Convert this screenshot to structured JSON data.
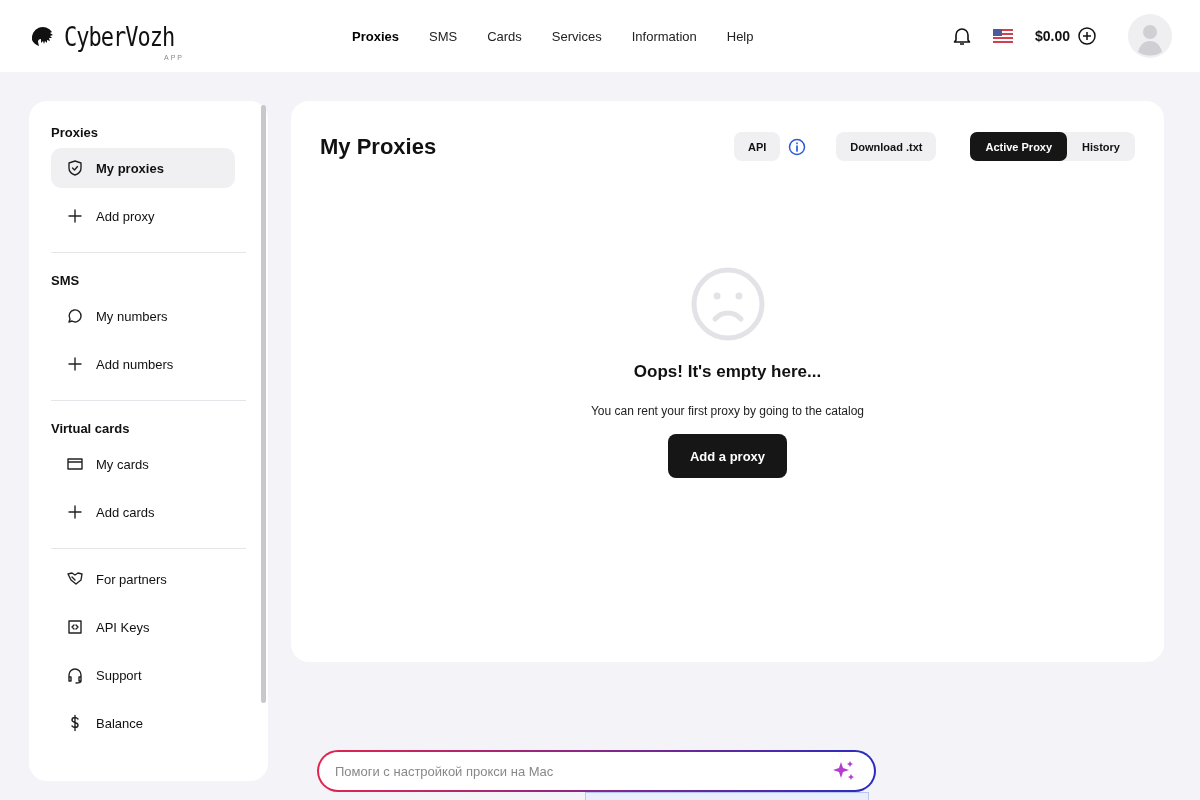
{
  "header": {
    "logo": {
      "name": "CyberVozh",
      "sub": "APP"
    },
    "nav": [
      {
        "label": "Proxies",
        "selected": true
      },
      {
        "label": "SMS",
        "selected": false
      },
      {
        "label": "Cards",
        "selected": false
      },
      {
        "label": "Services",
        "selected": false
      },
      {
        "label": "Information",
        "selected": false
      },
      {
        "label": "Help",
        "selected": false
      }
    ],
    "balance": "$0.00"
  },
  "sidebar": {
    "sections": [
      {
        "title": "Proxies",
        "items": [
          {
            "label": "My proxies",
            "selected": true
          },
          {
            "label": "Add proxy",
            "selected": false
          }
        ]
      },
      {
        "title": "SMS",
        "items": [
          {
            "label": "My numbers",
            "selected": false
          },
          {
            "label": "Add numbers",
            "selected": false
          }
        ]
      },
      {
        "title": "Virtual cards",
        "items": [
          {
            "label": "My cards",
            "selected": false
          },
          {
            "label": "Add cards",
            "selected": false
          }
        ]
      },
      {
        "items": [
          {
            "label": "For partners",
            "selected": false
          },
          {
            "label": "API Keys",
            "selected": false
          },
          {
            "label": "Support",
            "selected": false
          },
          {
            "label": "Balance",
            "selected": false
          }
        ]
      }
    ]
  },
  "main": {
    "title": "My Proxies",
    "api_button": "API",
    "download_button": "Download .txt",
    "toggle": [
      {
        "label": "Active Proxy",
        "selected": true
      },
      {
        "label": "History",
        "selected": false
      }
    ],
    "empty": {
      "heading": "Oops! It's empty here...",
      "text": "You can rent your first proxy by going to the catalog",
      "button": "Add a proxy"
    }
  },
  "assistant": {
    "placeholder": "Помоги с настройкой прокси на Mac"
  }
}
